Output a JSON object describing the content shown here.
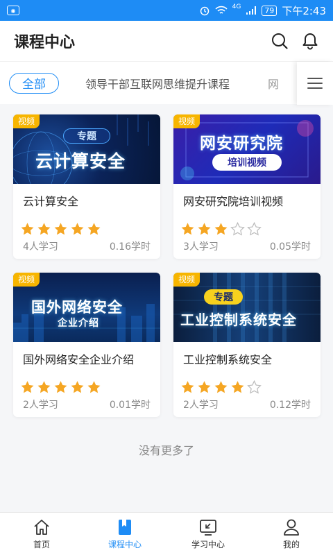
{
  "status_bar": {
    "battery": "79",
    "time": "下午2:43",
    "signal_label": "4G"
  },
  "header": {
    "title": "课程中心",
    "icons": [
      "search-icon",
      "bell-icon"
    ]
  },
  "tabs": {
    "active": "全部",
    "items": [
      "领导干部互联网思维提升课程",
      "网"
    ]
  },
  "courses": [
    {
      "badge": "视频",
      "thumb_label": "专题",
      "thumb_title": "云计算安全",
      "title": "云计算安全",
      "rating": 5,
      "learners": "4人学习",
      "hours": "0.16学时"
    },
    {
      "badge": "视频",
      "thumb_label": "培训视频",
      "thumb_title": "网安研究院",
      "title": "网安研究院培训视频",
      "rating": 3,
      "learners": "3人学习",
      "hours": "0.05学时"
    },
    {
      "badge": "视频",
      "thumb_label": "企业介绍",
      "thumb_title": "国外网络安全",
      "title": "国外网络安全企业介绍",
      "rating": 5,
      "learners": "2人学习",
      "hours": "0.01学时"
    },
    {
      "badge": "视频",
      "thumb_label": "专题",
      "thumb_title": "工业控制系统安全",
      "title": "工业控制系统安全",
      "rating": 4,
      "learners": "2人学习",
      "hours": "0.12学时"
    }
  ],
  "footer_text": "没有更多了",
  "bottom_nav": [
    {
      "label": "首页",
      "icon": "home-icon",
      "active": false
    },
    {
      "label": "课程中心",
      "icon": "book-icon",
      "active": true
    },
    {
      "label": "学习中心",
      "icon": "learning-icon",
      "active": false
    },
    {
      "label": "我的",
      "icon": "user-icon",
      "active": false
    }
  ],
  "colors": {
    "accent": "#1e8cf5",
    "star": "#f5a623",
    "badge": "#f7b500"
  }
}
